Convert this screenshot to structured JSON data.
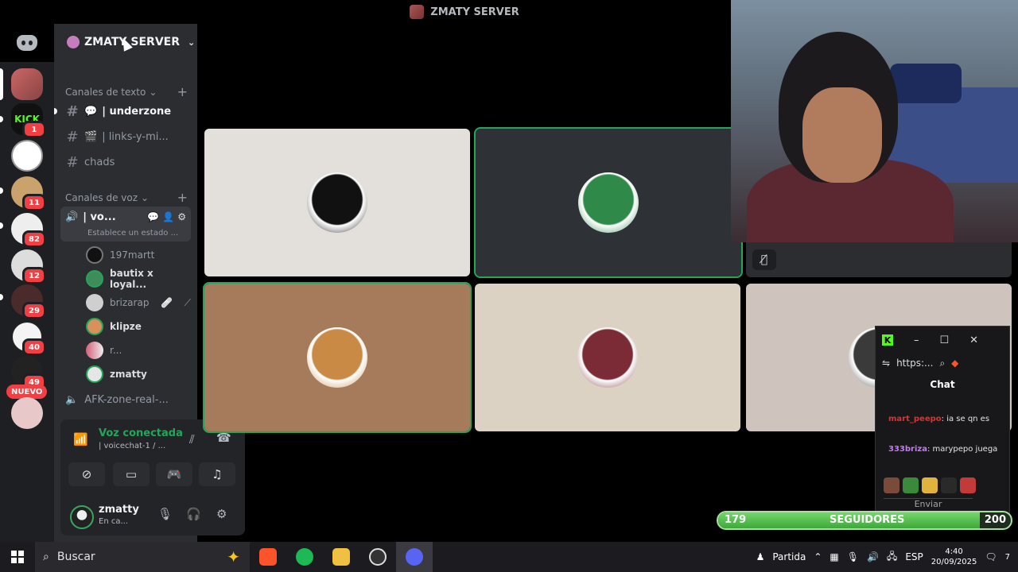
{
  "window": {
    "title": "ZMATY SERVER"
  },
  "server": {
    "name": "ZMATY SERVER"
  },
  "rail": {
    "badges": [
      "1",
      "11",
      "82",
      "12",
      "29",
      "40",
      "49"
    ],
    "new_label": "NUEVO"
  },
  "text_channels": {
    "category": "Canales de texto",
    "items": [
      {
        "emoji": "💬",
        "label": "| underzone"
      },
      {
        "emoji": "🎬",
        "label": "| links-y-mi..."
      },
      {
        "emoji": "",
        "label": "chads"
      }
    ]
  },
  "voice_channels": {
    "category": "Canales de voz",
    "active": {
      "label": "| vo...",
      "status": "Establece un estado ..."
    },
    "members": [
      {
        "name": "197martt",
        "color": "#111111"
      },
      {
        "name": "bautix x loyal...",
        "color": "#3f8c5a"
      },
      {
        "name": "brizarap",
        "color": "#cfcfcf"
      },
      {
        "name": "klipze",
        "color": "#d9905a"
      },
      {
        "name": "r...",
        "color": "#d45f7a"
      },
      {
        "name": "zmatty",
        "color": "#e6e6e6"
      }
    ],
    "afk": "AFK-zone-real-..."
  },
  "panel": {
    "voice_title": "Voz conectada",
    "voice_sub": "| voicechat-1 / ...",
    "username": "zmatty",
    "status": "En ca..."
  },
  "tiles": [
    {
      "bg": "#e3e0dc",
      "face": "#111111"
    },
    {
      "bg": "#2e3136",
      "face": "#2f8a4a"
    },
    {
      "bg": "#a67b5b",
      "face": "#c88a45"
    },
    {
      "bg": "#dbd2c4",
      "face": "#7a2b36"
    },
    {
      "bg": "#cfc4bd",
      "face": "#3a3a3a"
    }
  ],
  "kick": {
    "url": "https:...",
    "chat_title": "Chat",
    "messages": [
      {
        "user": "mart_peepo",
        "text": ": ia se qn es"
      },
      {
        "user": "333briza",
        "text": ": marypepo juega"
      }
    ],
    "send_label": "Enviar"
  },
  "followers": {
    "current": "179",
    "label": "SEGUIDORES",
    "goal": "200",
    "progress": 0.895
  },
  "taskbar": {
    "search_placeholder": "Buscar",
    "game_label": "Partida",
    "lang": "ESP",
    "time": "4:40",
    "date": "20/09/2025",
    "notif": "7"
  },
  "colors": {
    "accent_green": "#23a55a",
    "badge_red": "#f23f43",
    "kick_green": "#53fc18"
  }
}
